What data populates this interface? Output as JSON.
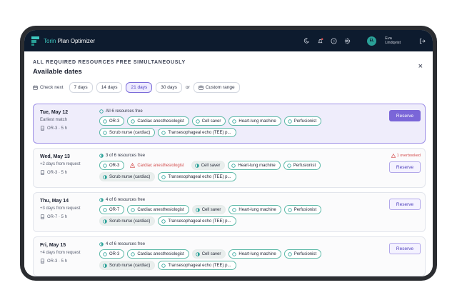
{
  "app": {
    "brand_a": "Torin",
    "brand_b": "Plan Optimizer",
    "user_initials": "EL",
    "user_first": "Eva",
    "user_last": "Lindqvist"
  },
  "panel": {
    "kicker": "ALL REQUIRED RESOURCES FREE SIMULTANEOUSLY",
    "title": "Available dates",
    "close": "×"
  },
  "filters": {
    "check_next": "Check next",
    "options": [
      "7 days",
      "14 days",
      "21 days",
      "30 days"
    ],
    "selected": "21 days",
    "or": "or",
    "custom": "Custom range"
  },
  "colors": {
    "accent": "#7a66d8",
    "teal": "#3ec7c0",
    "warn": "#d34a4a",
    "navbar": "#0d1b2e"
  },
  "dates": [
    {
      "date": "Tue, May 12",
      "sub": "Earliest match",
      "room": "OR-3 · 5 h",
      "free": "All 6 resources free",
      "reserve": "Reserve",
      "badge": "",
      "chips": [
        {
          "label": "OR-3",
          "state": "free"
        },
        {
          "label": "Cardiac anesthesiologist",
          "state": "free"
        },
        {
          "label": "Cell saver",
          "state": "free"
        },
        {
          "label": "Heart-lung machine",
          "state": "free"
        },
        {
          "label": "Perfusionist",
          "state": "free"
        },
        {
          "label": "Scrub nurse (cardiac)",
          "state": "free"
        },
        {
          "label": "Transesophageal echo (TEE) p...",
          "state": "free"
        }
      ]
    },
    {
      "date": "Wed, May 13",
      "sub": "+2 days from request",
      "room": "OR-3 · 5 h",
      "free": "3 of 6 resources free",
      "reserve": "Reserve",
      "badge": "1 overbooked",
      "chips": [
        {
          "label": "OR-3",
          "state": "free"
        },
        {
          "label": "Cardiac anesthesiologist",
          "state": "warn"
        },
        {
          "label": "Cell saver",
          "state": "partial"
        },
        {
          "label": "Heart-lung machine",
          "state": "free"
        },
        {
          "label": "Perfusionist",
          "state": "free"
        },
        {
          "label": "Scrub nurse (cardiac)",
          "state": "partial"
        },
        {
          "label": "Transesophageal echo (TEE) p...",
          "state": "free"
        }
      ]
    },
    {
      "date": "Thu, May 14",
      "sub": "+3 days from request",
      "room": "OR-7 · 5 h",
      "free": "4 of 6 resources free",
      "reserve": "Reserve",
      "badge": "",
      "chips": [
        {
          "label": "OR-7",
          "state": "free"
        },
        {
          "label": "Cardiac anesthesiologist",
          "state": "free"
        },
        {
          "label": "Cell saver",
          "state": "partial"
        },
        {
          "label": "Heart-lung machine",
          "state": "free"
        },
        {
          "label": "Perfusionist",
          "state": "free"
        },
        {
          "label": "Scrub nurse (cardiac)",
          "state": "partial"
        },
        {
          "label": "Transesophageal echo (TEE) p...",
          "state": "free"
        }
      ]
    },
    {
      "date": "Fri, May 15",
      "sub": "+4 days from request",
      "room": "OR-3 · 5 h",
      "free": "4 of 6 resources free",
      "reserve": "Reserve",
      "badge": "",
      "chips": [
        {
          "label": "OR-3",
          "state": "free"
        },
        {
          "label": "Cardiac anesthesiologist",
          "state": "free"
        },
        {
          "label": "Cell saver",
          "state": "partial"
        },
        {
          "label": "Heart-lung machine",
          "state": "free"
        },
        {
          "label": "Perfusionist",
          "state": "free"
        },
        {
          "label": "Scrub nurse (cardiac)",
          "state": "partial"
        },
        {
          "label": "Transesophageal echo (TEE) p...",
          "state": "free"
        }
      ]
    }
  ]
}
